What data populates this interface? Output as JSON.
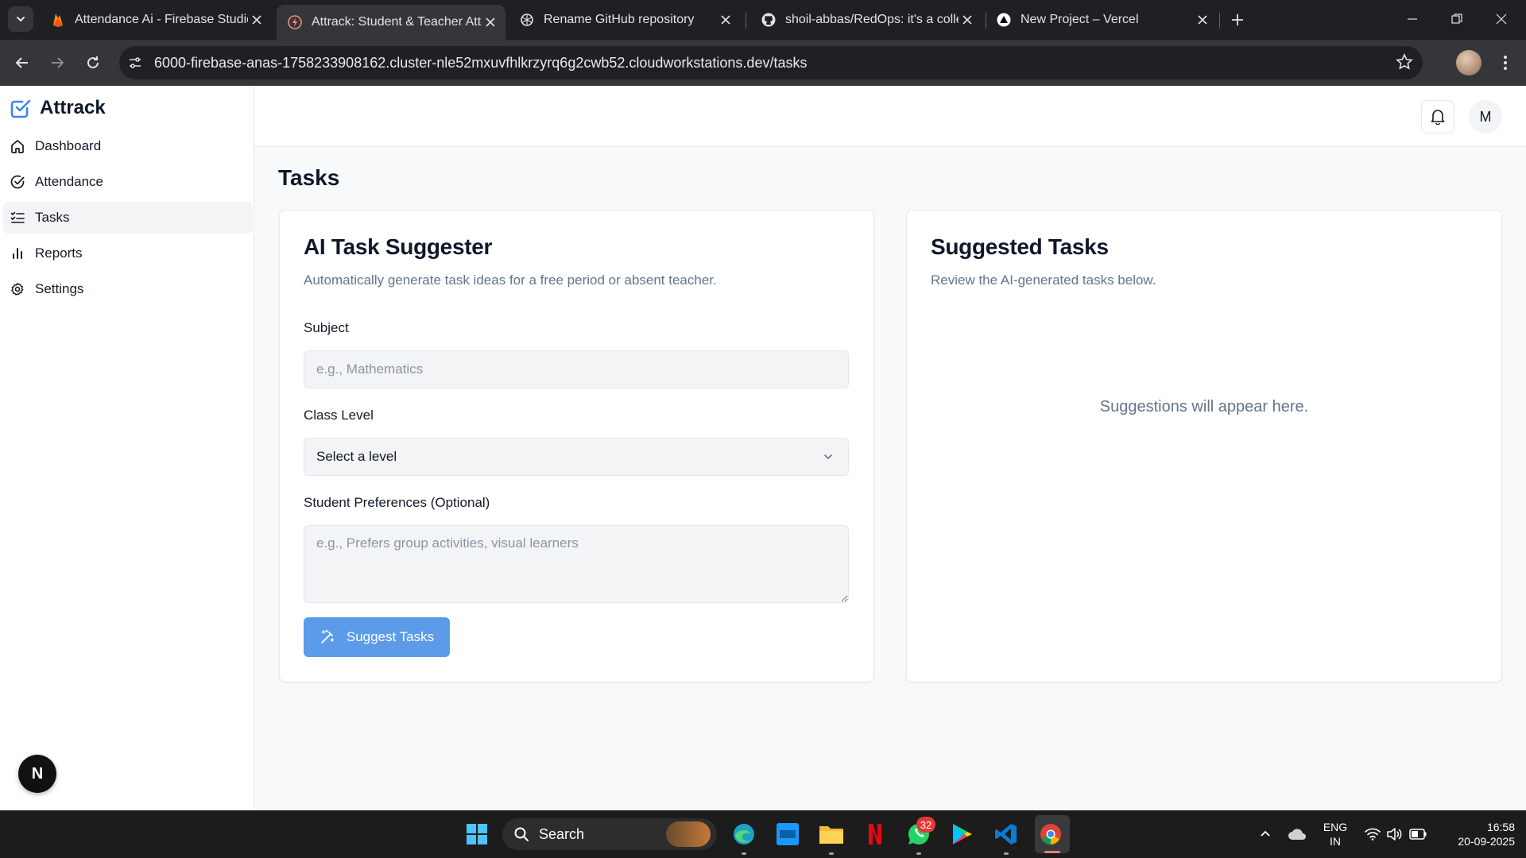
{
  "browser": {
    "tabs": [
      {
        "title": "Attendance Ai - Firebase Studio",
        "icon": "firebase-icon"
      },
      {
        "title": "Attrack: Student & Teacher Atte",
        "icon": "attrack-favicon-icon",
        "active": true
      },
      {
        "title": "Rename GitHub repository",
        "icon": "openai-icon"
      },
      {
        "title": "shoil-abbas/RedOps: it's a colle",
        "icon": "github-icon"
      },
      {
        "title": "New Project – Vercel",
        "icon": "vercel-icon"
      }
    ],
    "url": "6000-firebase-anas-1758233908162.cluster-nle52mxuvfhlkrzyrq6g2cwb52.cloudworkstations.dev/tasks"
  },
  "app": {
    "brand": "Attrack",
    "accent_color": "#3b82f6",
    "nav": [
      {
        "label": "Dashboard",
        "icon": "home-icon"
      },
      {
        "label": "Attendance",
        "icon": "check-circle-icon"
      },
      {
        "label": "Tasks",
        "icon": "list-checks-icon",
        "active": true
      },
      {
        "label": "Reports",
        "icon": "bar-chart-icon"
      },
      {
        "label": "Settings",
        "icon": "gear-icon"
      }
    ],
    "avatar_initial": "M",
    "dev_badge": "N"
  },
  "page": {
    "title": "Tasks",
    "suggester": {
      "title": "AI Task Suggester",
      "description": "Automatically generate task ideas for a free period or absent teacher.",
      "subject_label": "Subject",
      "subject_placeholder": "e.g., Mathematics",
      "subject_value": "",
      "class_level_label": "Class Level",
      "class_level_value": "Select a level",
      "preferences_label": "Student Preferences (Optional)",
      "preferences_placeholder": "e.g., Prefers group activities, visual learners",
      "submit_label": "Suggest Tasks",
      "button_color": "#5b9be8"
    },
    "suggested": {
      "title": "Suggested Tasks",
      "description": "Review the AI-generated tasks below.",
      "empty_message": "Suggestions will appear here."
    }
  },
  "taskbar": {
    "search_label": "Search",
    "whatsapp_badge": "32",
    "language": "ENG",
    "region": "IN",
    "time": "16:58",
    "date": "20-09-2025"
  }
}
